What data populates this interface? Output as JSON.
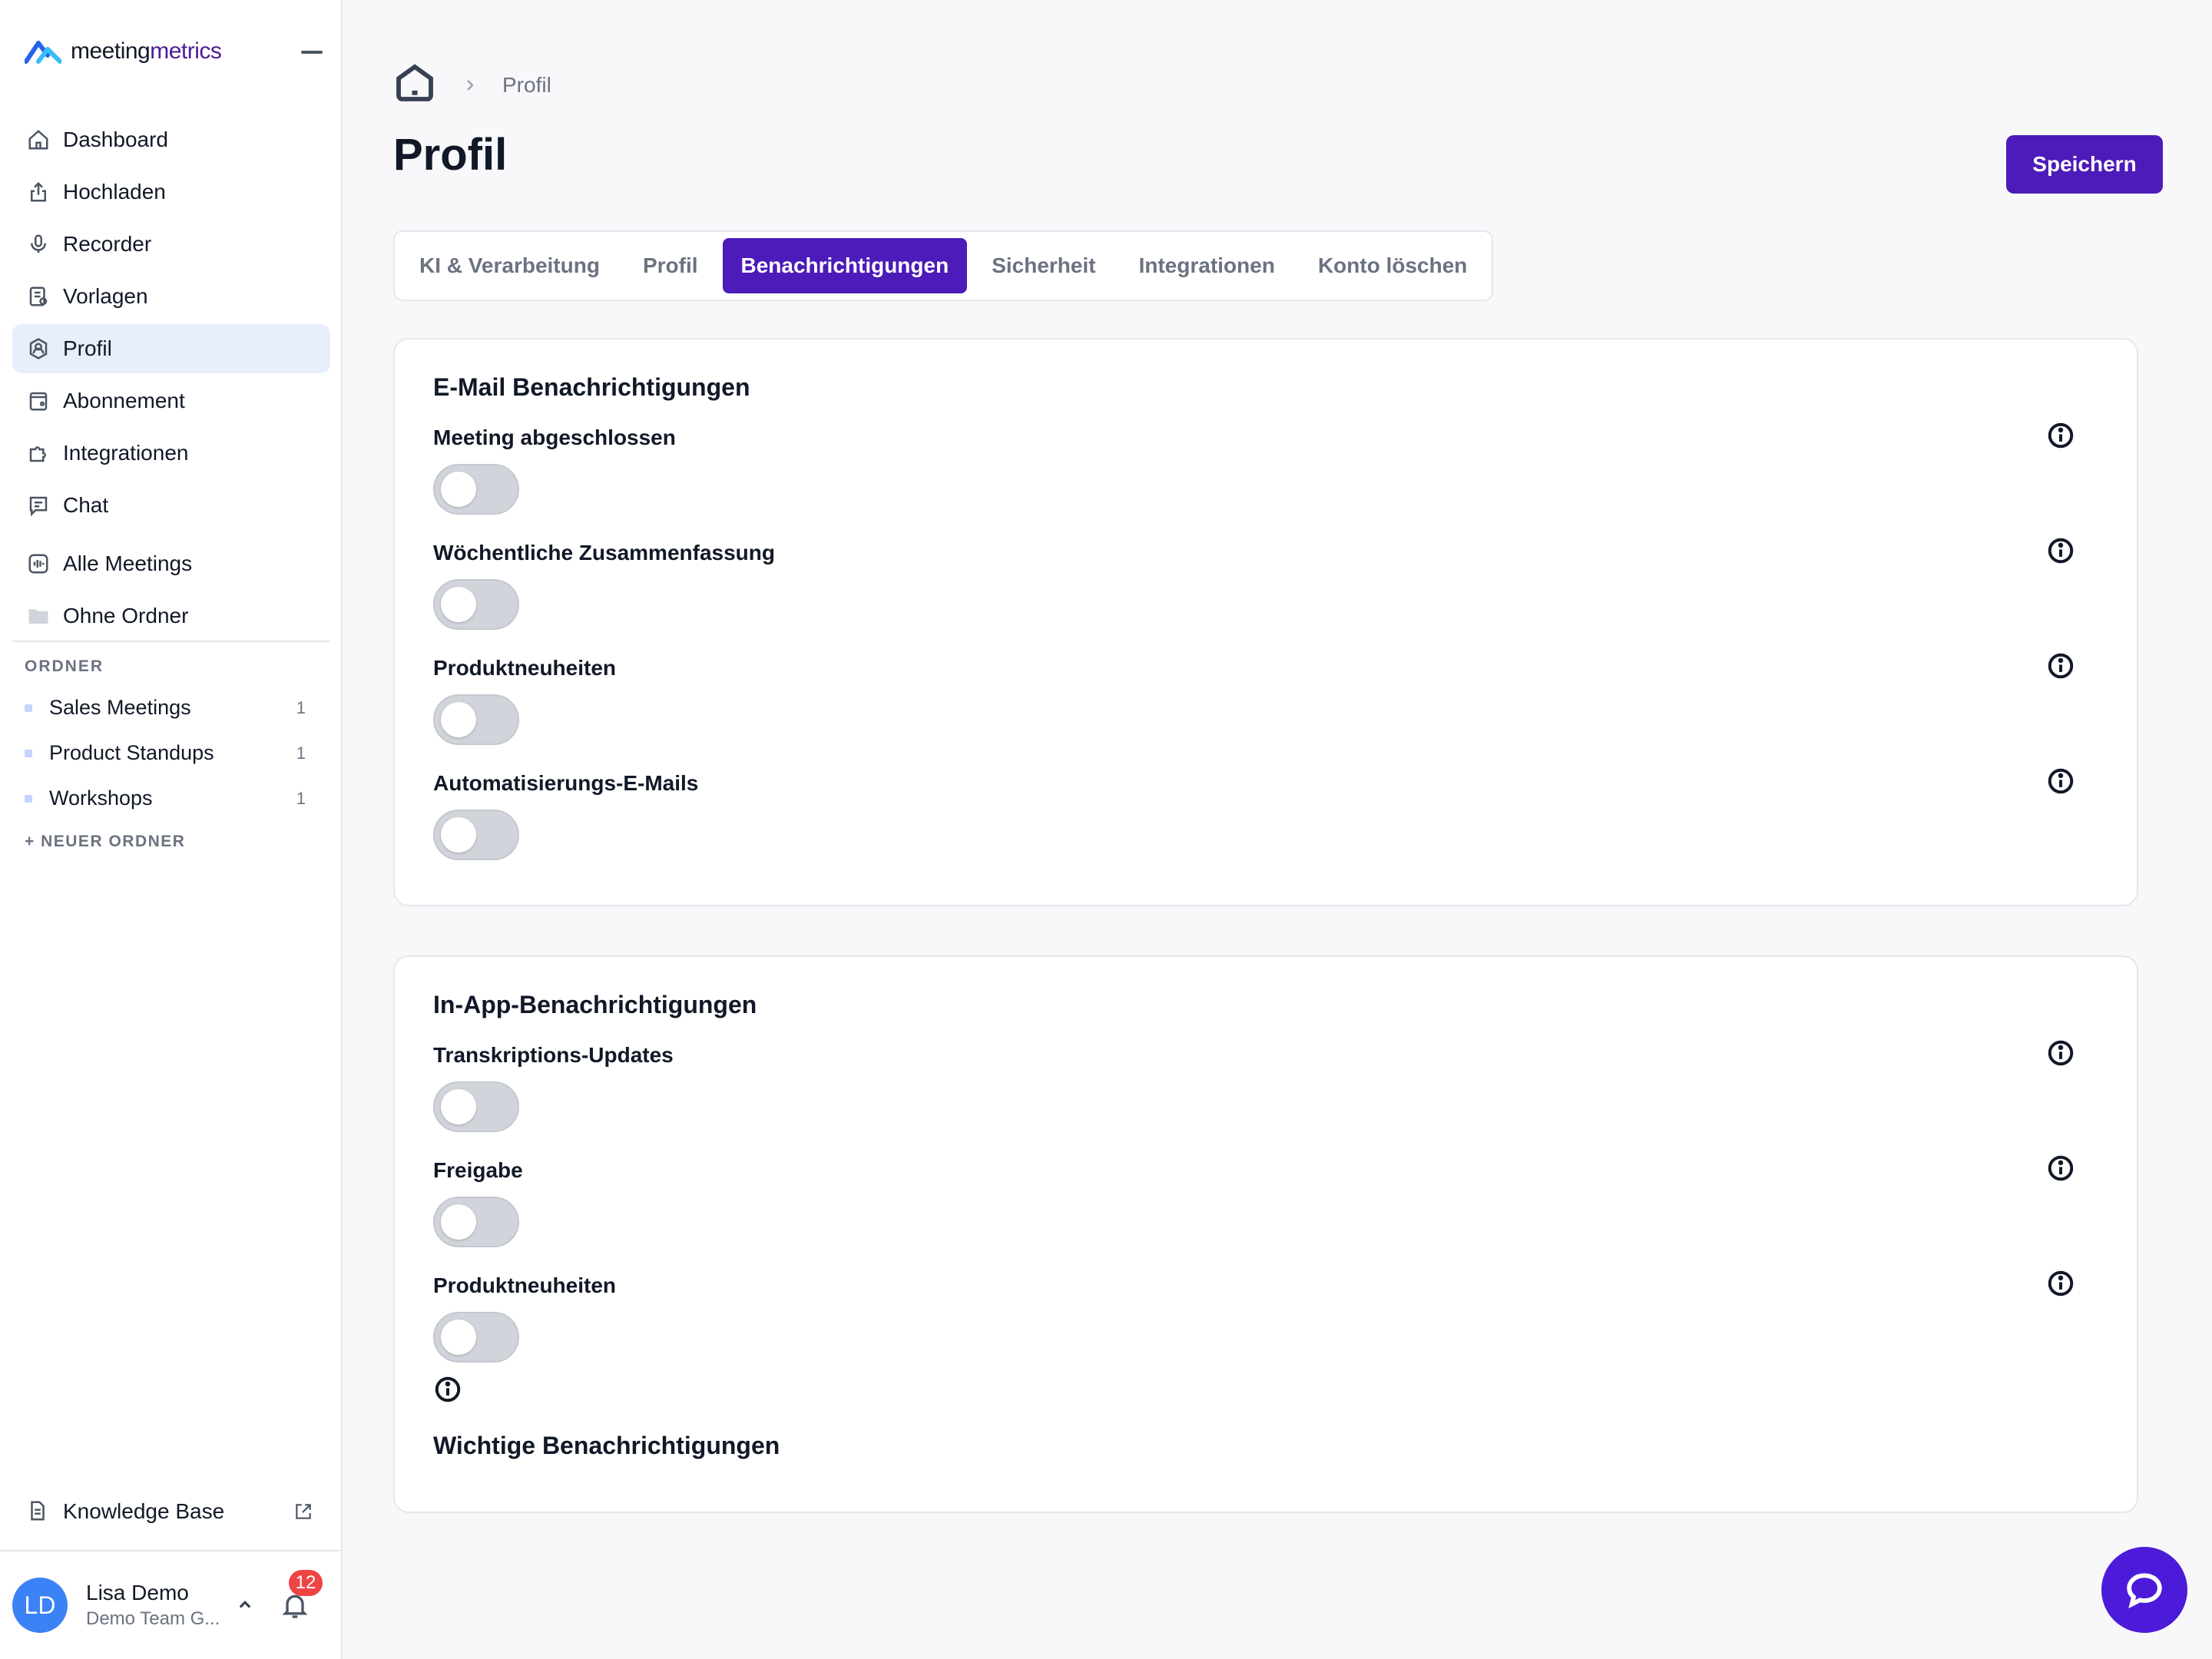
{
  "app": {
    "logo_part1": "meeting",
    "logo_part2": "metrics"
  },
  "colors": {
    "accent": "#4c1bb9",
    "active_nav": "#e8effc",
    "badge": "#ef4444",
    "avatar": "#3b82f6"
  },
  "sidebar": {
    "items": [
      {
        "label": "Dashboard",
        "icon": "home-icon"
      },
      {
        "label": "Hochladen",
        "icon": "upload-icon"
      },
      {
        "label": "Recorder",
        "icon": "microphone-icon"
      },
      {
        "label": "Vorlagen",
        "icon": "template-icon"
      },
      {
        "label": "Profil",
        "icon": "profile-gear-icon",
        "active": true
      },
      {
        "label": "Abonnement",
        "icon": "wallet-icon"
      },
      {
        "label": "Integrationen",
        "icon": "puzzle-icon"
      },
      {
        "label": "Chat",
        "icon": "chat-icon"
      },
      {
        "label": "Alle Meetings",
        "icon": "audio-wave-icon"
      },
      {
        "label": "Ohne Ordner",
        "icon": "folder-icon"
      }
    ],
    "folders_heading": "ORDNER",
    "folders": [
      {
        "name": "Sales Meetings",
        "count": "1"
      },
      {
        "name": "Product Standups",
        "count": "1"
      },
      {
        "name": "Workshops",
        "count": "1"
      }
    ],
    "new_folder": "+ NEUER ORDNER",
    "knowledge_base": "Knowledge Base",
    "user": {
      "initials": "LD",
      "name": "Lisa Demo",
      "team": "Demo Team G...",
      "notifications": "12"
    }
  },
  "header": {
    "breadcrumb": "Profil",
    "title": "Profil",
    "save_label": "Speichern"
  },
  "tabs": [
    {
      "label": "KI & Verarbeitung"
    },
    {
      "label": "Profil"
    },
    {
      "label": "Benachrichtigungen",
      "active": true
    },
    {
      "label": "Sicherheit"
    },
    {
      "label": "Integrationen"
    },
    {
      "label": "Konto löschen"
    }
  ],
  "email_section": {
    "title": "E-Mail Benachrichtigungen",
    "settings": [
      {
        "label": "Meeting abgeschlossen",
        "enabled": false
      },
      {
        "label": "Wöchentliche Zusammenfassung",
        "enabled": false
      },
      {
        "label": "Produktneuheiten",
        "enabled": false
      },
      {
        "label": "Automatisierungs-E-Mails",
        "enabled": false
      }
    ]
  },
  "inapp_section": {
    "title": "In-App-Benachrichtigungen",
    "settings": [
      {
        "label": "Transkriptions-Updates",
        "enabled": false
      },
      {
        "label": "Freigabe",
        "enabled": false
      },
      {
        "label": "Produktneuheiten",
        "enabled": false
      }
    ],
    "important_title": "Wichtige Benachrichtigungen"
  }
}
